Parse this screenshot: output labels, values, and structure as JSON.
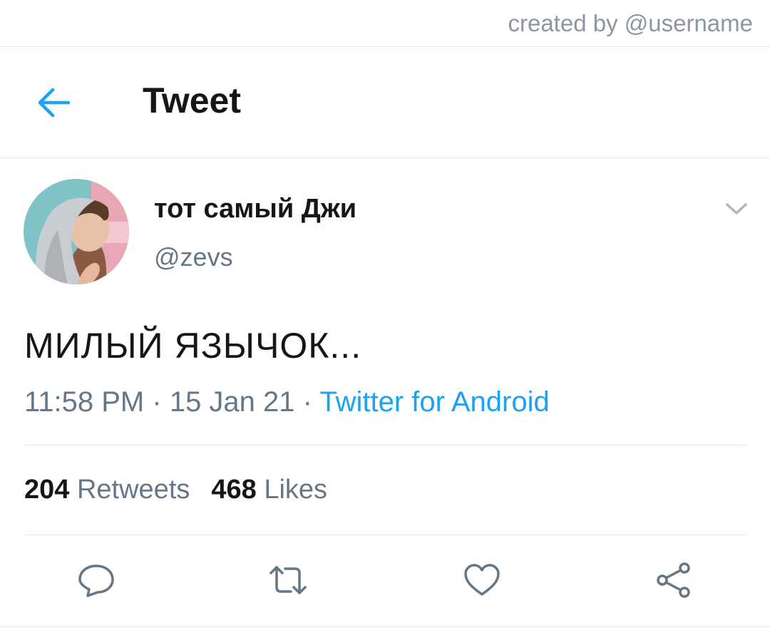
{
  "watermark": {
    "credit": "created by @username"
  },
  "header": {
    "title": "Tweet",
    "back_icon": "arrow-left-icon",
    "accent_color": "#1da1f2"
  },
  "author": {
    "display_name": "тот самый Джи",
    "handle": "@zevs",
    "menu_icon": "chevron-down-icon"
  },
  "tweet": {
    "text": "МИЛЫЙ ЯЗЫЧОК...",
    "time": "11:58 PM",
    "separator": "·",
    "date": "15 Jan 21",
    "source": "Twitter for Android"
  },
  "stats": {
    "retweets_count": "204",
    "retweets_label": "Retweets",
    "likes_count": "468",
    "likes_label": "Likes"
  },
  "actions": [
    {
      "icon": "reply-icon"
    },
    {
      "icon": "retweet-icon"
    },
    {
      "icon": "like-heart-icon"
    },
    {
      "icon": "share-icon"
    }
  ],
  "colors": {
    "text_primary": "#14171a",
    "text_secondary": "#657786",
    "divider": "#e1e8ed",
    "icon_gray": "#657786"
  }
}
